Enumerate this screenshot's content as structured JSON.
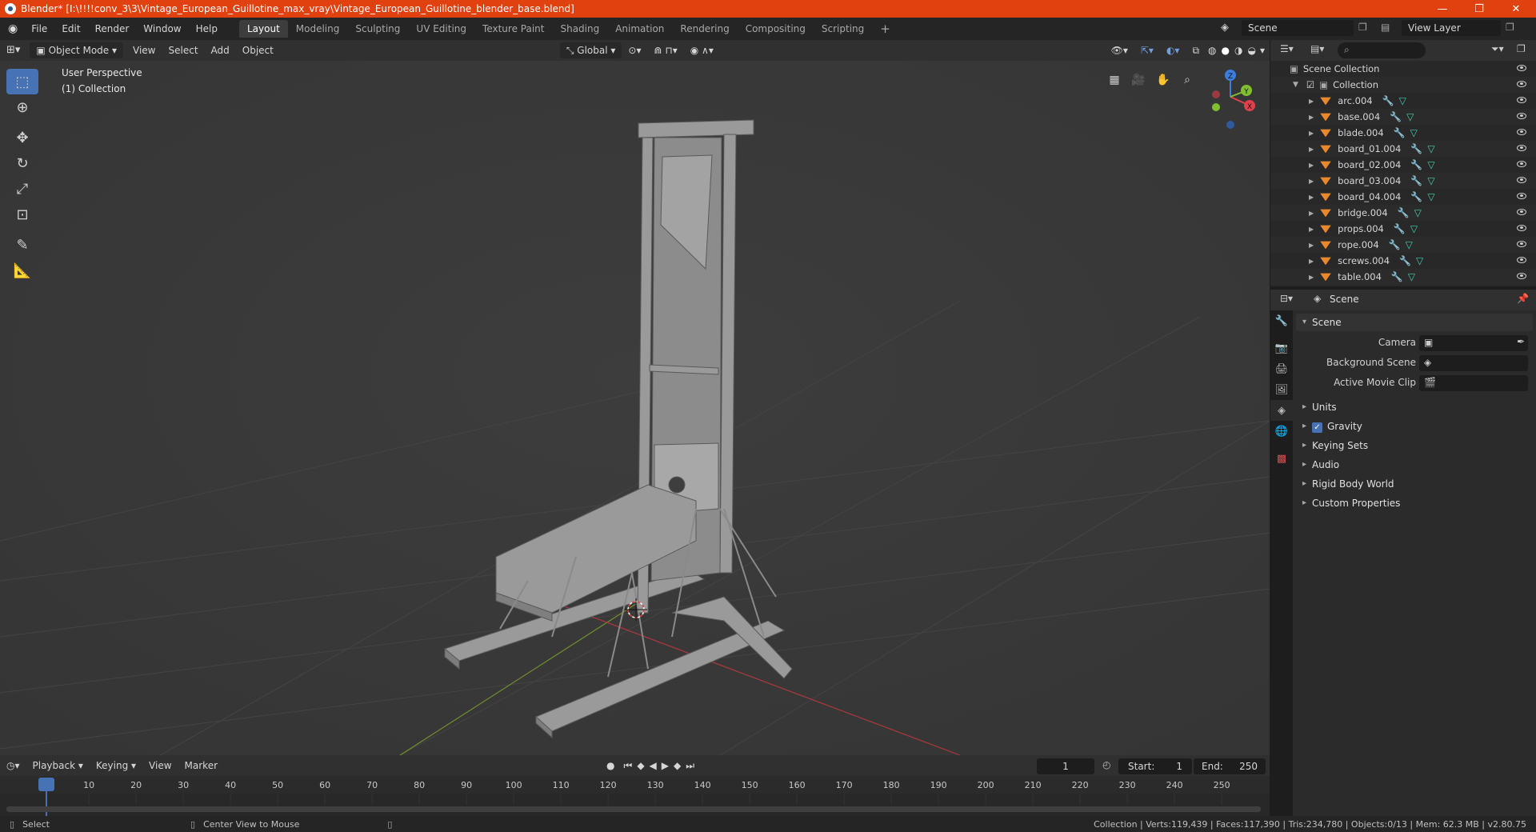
{
  "window": {
    "title": "Blender* [I:\\!!!!conv_3\\3\\Vintage_European_Guillotine_max_vray\\Vintage_European_Guillotine_blender_base.blend]",
    "minimize": "—",
    "maximize": "❐",
    "close": "✕"
  },
  "menu": [
    "File",
    "Edit",
    "Render",
    "Window",
    "Help"
  ],
  "workspaces": [
    "Layout",
    "Modeling",
    "Sculpting",
    "UV Editing",
    "Texture Paint",
    "Shading",
    "Animation",
    "Rendering",
    "Compositing",
    "Scripting"
  ],
  "workspace_add": "+",
  "scene_selector": "Scene",
  "view_layer": "View Layer",
  "viewport_header": {
    "mode": "Object Mode",
    "menus": [
      "View",
      "Select",
      "Add",
      "Object"
    ],
    "transform_orientation": "Global"
  },
  "viewport": {
    "perspective": "User Perspective",
    "collection": "(1) Collection",
    "gizmo_labels": {
      "z": "Z",
      "y": "Y",
      "x": "X"
    }
  },
  "outliner": {
    "search_placeholder": "",
    "root": "Scene Collection",
    "collection": "Collection",
    "objects": [
      "arc.004",
      "base.004",
      "blade.004",
      "board_01.004",
      "board_02.004",
      "board_03.004",
      "board_04.004",
      "bridge.004",
      "props.004",
      "rope.004",
      "screws.004",
      "table.004"
    ]
  },
  "properties": {
    "header": "Scene",
    "panel_title": "Scene",
    "camera_label": "Camera",
    "background_scene_label": "Background Scene",
    "active_movie_clip_label": "Active Movie Clip",
    "panels": [
      "Units",
      "Gravity",
      "Keying Sets",
      "Audio",
      "Rigid Body World",
      "Custom Properties"
    ],
    "gravity_checked": true
  },
  "timeline": {
    "menus": [
      "Playback",
      "Keying",
      "View",
      "Marker"
    ],
    "current_frame": "1",
    "start_label": "Start:",
    "start": "1",
    "end_label": "End:",
    "end": "250",
    "ruler": [
      "1",
      "10",
      "20",
      "30",
      "40",
      "50",
      "60",
      "70",
      "80",
      "90",
      "100",
      "110",
      "120",
      "130",
      "140",
      "150",
      "160",
      "170",
      "180",
      "190",
      "200",
      "210",
      "220",
      "230",
      "240",
      "250"
    ]
  },
  "statusbar": {
    "select": "Select",
    "center_view": "Center View to Mouse",
    "stats": "Collection | Verts:119,439 | Faces:117,390 | Tris:234,780 | Objects:0/13 | Mem: 62.3 MB | v2.80.75"
  },
  "colors": {
    "title_bar": "#e1410f",
    "accent": "#4772b3",
    "viewport_bg": "#393939",
    "axis_x": "#e0404a",
    "axis_y": "#80c030",
    "axis_z": "#3a7ee0",
    "object_icon": "#e8892e"
  }
}
